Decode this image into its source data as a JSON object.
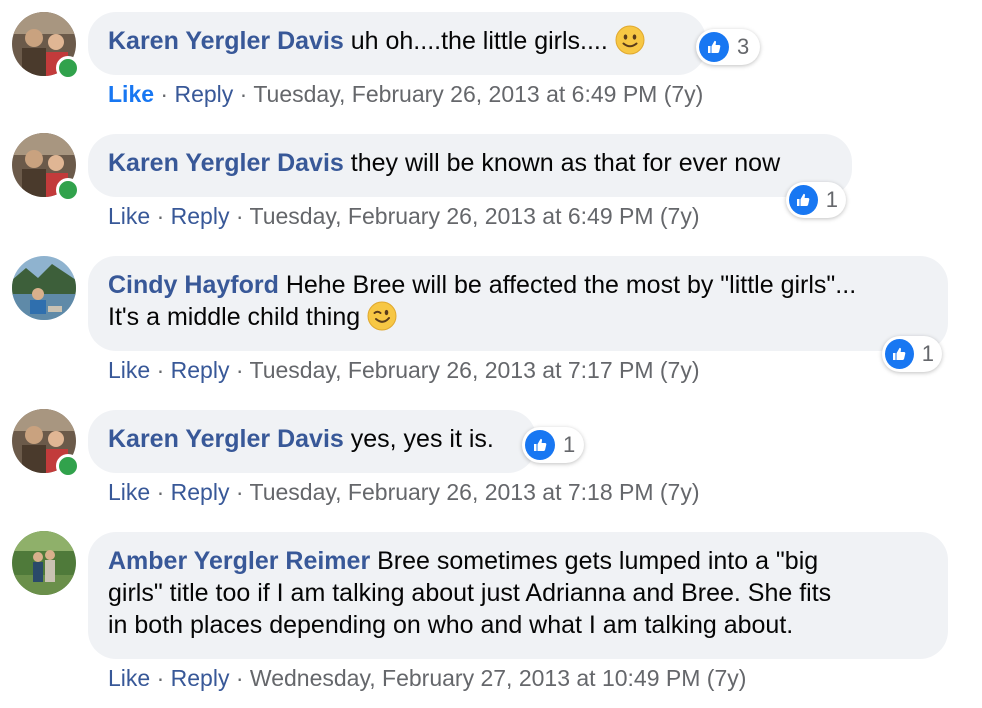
{
  "colors": {
    "author": "#385898",
    "like_active": "#1877f2",
    "bubble": "#f0f2f5",
    "online": "#31a24c"
  },
  "comments": [
    {
      "author": "Karen Yergler Davis",
      "text": "uh oh....the little girls....",
      "emoji": "slightly-smiling-face",
      "like": "Like",
      "reply": "Reply",
      "timestamp": "Tuesday, February 26, 2013 at 6:49 PM (7y)",
      "reactions": "3"
    },
    {
      "author": "Karen Yergler Davis",
      "text": "they will be known as that for ever now",
      "like": "Like",
      "reply": "Reply",
      "timestamp": "Tuesday, February 26, 2013 at 6:49 PM (7y)",
      "reactions": "1"
    },
    {
      "author": "Cindy Hayford",
      "text_line1": "Hehe Bree will be affected the most by \"little girls\"...",
      "text_line2": "It's a middle child thing",
      "emoji": "winking-face",
      "like": "Like",
      "reply": "Reply",
      "timestamp": "Tuesday, February 26, 2013 at 7:17 PM (7y)",
      "reactions": "1"
    },
    {
      "author": "Karen Yergler Davis",
      "text": "yes, yes it is.",
      "like": "Like",
      "reply": "Reply",
      "timestamp": "Tuesday, February 26, 2013 at 7:18 PM (7y)",
      "reactions": "1"
    },
    {
      "author": "Amber Yergler Reimer",
      "text_line1": "Bree sometimes gets lumped into a \"big",
      "text_line2": "girls\" title too if I am talking about just Adrianna and Bree. She fits",
      "text_line3": "in both places depending on who and what I am talking about.",
      "like": "Like",
      "reply": "Reply",
      "timestamp": "Wednesday, February 27, 2013 at 10:49 PM (7y)"
    }
  ]
}
